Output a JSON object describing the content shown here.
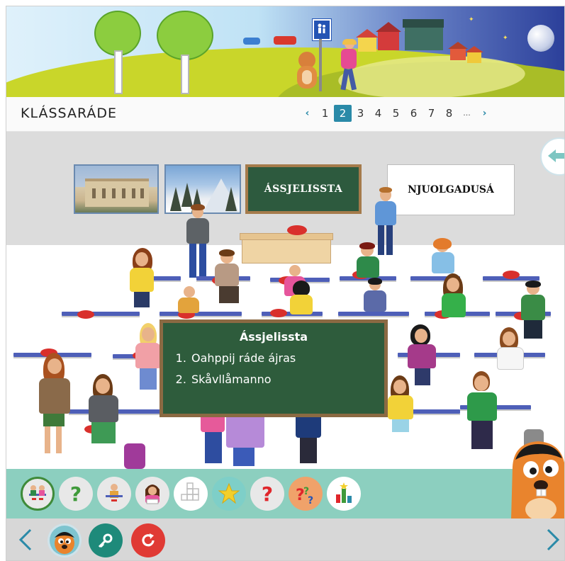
{
  "header": {
    "title": "KLÁSSARÁDE",
    "pager": {
      "prev_label": "‹",
      "next_label": "›",
      "pages": [
        "1",
        "2",
        "3",
        "4",
        "5",
        "6",
        "7",
        "8"
      ],
      "active_page": "2",
      "ellipsis": "..."
    }
  },
  "scene": {
    "board_button_label": "ÁSSJELISSTA",
    "whiteboard_button_label": "NJUOLGADUSÁ",
    "back_button_icon": "arrow-left-icon"
  },
  "popup": {
    "title": "Ássjelissta",
    "items": [
      "Oahppij ráde ájras",
      "Skåvllåmanno"
    ]
  },
  "toolbar": {
    "tools": [
      {
        "icon": "classroom-icon",
        "selected": true
      },
      {
        "icon": "question-mark-icon",
        "color": "#3f9a3a"
      },
      {
        "icon": "student-desk-icon"
      },
      {
        "icon": "reading-girl-icon"
      },
      {
        "icon": "crossword-icon"
      },
      {
        "icon": "star-icon",
        "color": "#f2cf2a"
      },
      {
        "icon": "question-mark-icon",
        "color": "#e0262b"
      },
      {
        "icon": "multi-question-icon"
      },
      {
        "icon": "score-chart-icon"
      }
    ]
  },
  "bottom_nav": {
    "prev_icon": "chevron-left-icon",
    "next_icon": "chevron-right-icon",
    "avatar_icon": "beaver-avatar-icon",
    "key_icon": "key-icon",
    "refresh_icon": "refresh-icon"
  },
  "colors": {
    "accent": "#2a8aa8",
    "chalkboard": "#2e5c3c",
    "toolbar": "#8ccfbf",
    "red_button": "#e03a34",
    "teal_button": "#1e8a7a"
  }
}
